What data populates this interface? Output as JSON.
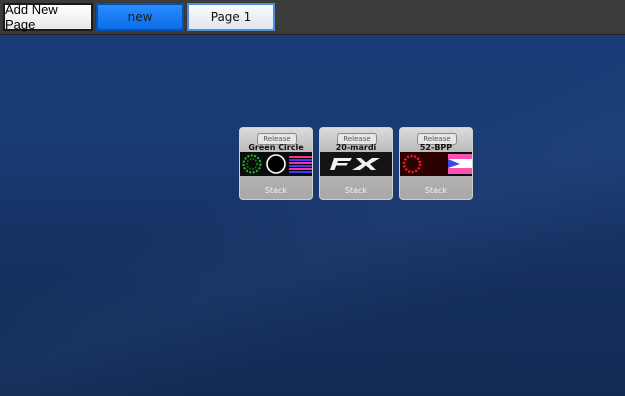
{
  "toolbar": {
    "add_new_page_label": "Add New Page",
    "tabs": [
      {
        "label": "new",
        "active": true
      },
      {
        "label": "Page 1",
        "active": false
      }
    ]
  },
  "colors": {
    "background_top": "#1b3d78",
    "background_bottom": "#122a53",
    "toolbar": "#3b3b3b",
    "active_tab": "#0b6de8"
  },
  "cards": [
    {
      "release_label": "Release",
      "title": "Green Circle",
      "stack_label": "Stack",
      "icons": [
        "green-ring-icon",
        "white-ring-icon",
        "stripes-flag-icon"
      ]
    },
    {
      "release_label": "Release",
      "title": "20-mardi",
      "stack_label": "Stack",
      "icons": [
        "fx-logo-icon"
      ]
    },
    {
      "release_label": "Release",
      "title": "52-BPP",
      "stack_label": "Stack",
      "icons": [
        "red-ring-icon",
        "flag-icon"
      ]
    }
  ]
}
